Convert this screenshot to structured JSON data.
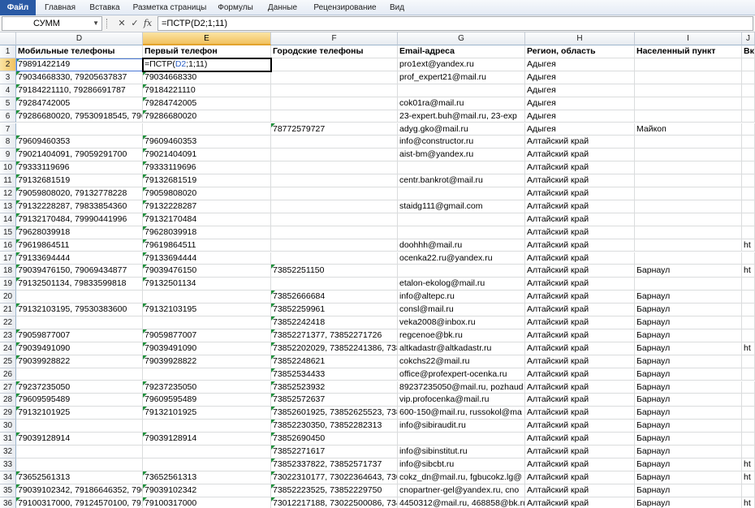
{
  "ribbon": {
    "tabs": [
      "Файл",
      "Главная",
      "Вставка",
      "Разметка страницы",
      "Формулы",
      "Данные",
      "Рецензирование",
      "Вид"
    ]
  },
  "formula_bar": {
    "name_box": "СУММ",
    "formula": "=ПСТР(D2;1;11)"
  },
  "active_cell": {
    "fn": "=ПСТР(",
    "ref": "D2",
    "rest": ";1;11)"
  },
  "columns": [
    "D",
    "E",
    "F",
    "G",
    "H",
    "I",
    "J"
  ],
  "header_row": [
    "Мобильные телефоны",
    "Первый телефон",
    "Городские телефоны",
    "Email-адреса",
    "Регион, область",
    "Населенный пункт",
    "Вк"
  ],
  "rows": [
    {
      "n": "2",
      "D": "79891422149",
      "E": "",
      "F": "",
      "G": "pro1ext@yandex.ru",
      "H": "Адыгея",
      "I": "",
      "J": ""
    },
    {
      "n": "3",
      "D": "79034668330, 79205637837",
      "E": "79034668330",
      "F": "",
      "G": "prof_expert21@mail.ru",
      "H": "Адыгея",
      "I": "",
      "J": ""
    },
    {
      "n": "4",
      "D": "79184221110, 79286691787",
      "E": "79184221110",
      "F": "",
      "G": "",
      "H": "Адыгея",
      "I": "",
      "J": ""
    },
    {
      "n": "5",
      "D": "79284742005",
      "E": "79284742005",
      "F": "",
      "G": "cok01ra@mail.ru",
      "H": "Адыгея",
      "I": "",
      "J": ""
    },
    {
      "n": "6",
      "D": "79286680020, 79530918545, 7961",
      "E": "79286680020",
      "F": "",
      "G": "23-expert.buh@mail.ru, 23-exp",
      "H": "Адыгея",
      "I": "",
      "J": ""
    },
    {
      "n": "7",
      "D": "",
      "E": "",
      "F": "78772579727",
      "G": "adyg.gko@mail.ru",
      "H": "Адыгея",
      "I": "Майкоп",
      "J": ""
    },
    {
      "n": "8",
      "D": "79609460353",
      "E": "79609460353",
      "F": "",
      "G": "info@constructor.ru",
      "H": "Алтайский край",
      "I": "",
      "J": ""
    },
    {
      "n": "9",
      "D": "79021404091, 79059291700",
      "E": "79021404091",
      "F": "",
      "G": "aist-bm@yandex.ru",
      "H": "Алтайский край",
      "I": "",
      "J": ""
    },
    {
      "n": "10",
      "D": "79333119696",
      "E": "79333119696",
      "F": "",
      "G": "",
      "H": "Алтайский край",
      "I": "",
      "J": ""
    },
    {
      "n": "11",
      "D": "79132681519",
      "E": "79132681519",
      "F": "",
      "G": "centr.bankrot@mail.ru",
      "H": "Алтайский край",
      "I": "",
      "J": ""
    },
    {
      "n": "12",
      "D": "79059808020, 79132778228",
      "E": "79059808020",
      "F": "",
      "G": "",
      "H": "Алтайский край",
      "I": "",
      "J": ""
    },
    {
      "n": "13",
      "D": "79132228287, 79833854360",
      "E": "79132228287",
      "F": "",
      "G": "staidg111@gmail.com",
      "H": "Алтайский край",
      "I": "",
      "J": ""
    },
    {
      "n": "14",
      "D": "79132170484, 79990441996",
      "E": "79132170484",
      "F": "",
      "G": "",
      "H": "Алтайский край",
      "I": "",
      "J": ""
    },
    {
      "n": "15",
      "D": "79628039918",
      "E": "79628039918",
      "F": "",
      "G": "",
      "H": "Алтайский край",
      "I": "",
      "J": ""
    },
    {
      "n": "16",
      "D": "79619864511",
      "E": "79619864511",
      "F": "",
      "G": "doohhh@mail.ru",
      "H": "Алтайский край",
      "I": "",
      "J": "ht"
    },
    {
      "n": "17",
      "D": "79133694444",
      "E": "79133694444",
      "F": "",
      "G": "ocenka22.ru@yandex.ru",
      "H": "Алтайский край",
      "I": "",
      "J": ""
    },
    {
      "n": "18",
      "D": "79039476150, 79069434877",
      "E": "79039476150",
      "F": "73852251150",
      "G": "",
      "H": "Алтайский край",
      "I": "Барнаул",
      "J": "ht"
    },
    {
      "n": "19",
      "D": "79132501134, 79833599818",
      "E": "79132501134",
      "F": "",
      "G": "etalon-ekolog@mail.ru",
      "H": "Алтайский край",
      "I": "",
      "J": ""
    },
    {
      "n": "20",
      "D": "",
      "E": "",
      "F": "73852666684",
      "G": "info@altepc.ru",
      "H": "Алтайский край",
      "I": "Барнаул",
      "J": ""
    },
    {
      "n": "21",
      "D": "79132103195, 79530383600",
      "E": "79132103195",
      "F": "73852259961",
      "G": "consl@mail.ru",
      "H": "Алтайский край",
      "I": "Барнаул",
      "J": ""
    },
    {
      "n": "22",
      "D": "",
      "E": "",
      "F": "73852242418",
      "G": "veka2008@inbox.ru",
      "H": "Алтайский край",
      "I": "Барнаул",
      "J": ""
    },
    {
      "n": "23",
      "D": "79059877007",
      "E": "79059877007",
      "F": "73852271377, 73852271726",
      "G": "regcenoe@bk.ru",
      "H": "Алтайский край",
      "I": "Барнаул",
      "J": ""
    },
    {
      "n": "24",
      "D": "79039491090",
      "E": "79039491090",
      "F": "73852202029, 73852241386, 7385",
      "G": "altkadastr@altkadastr.ru",
      "H": "Алтайский край",
      "I": "Барнаул",
      "J": "ht"
    },
    {
      "n": "25",
      "D": "79039928822",
      "E": "79039928822",
      "F": "73852248621",
      "G": "cokchs22@mail.ru",
      "H": "Алтайский край",
      "I": "Барнаул",
      "J": ""
    },
    {
      "n": "26",
      "D": "",
      "E": "",
      "F": "73852534433",
      "G": "office@profexpert-ocenka.ru",
      "H": "Алтайский край",
      "I": "Барнаул",
      "J": ""
    },
    {
      "n": "27",
      "D": "79237235050",
      "E": "79237235050",
      "F": "73852523932",
      "G": "89237235050@mail.ru, pozhaud",
      "H": "Алтайский край",
      "I": "Барнаул",
      "J": ""
    },
    {
      "n": "28",
      "D": "79609595489",
      "E": "79609595489",
      "F": "73852572637",
      "G": "vip.profocenka@mail.ru",
      "H": "Алтайский край",
      "I": "Барнаул",
      "J": ""
    },
    {
      "n": "29",
      "D": "79132101925",
      "E": "79132101925",
      "F": "73852601925, 73852625523, 7385",
      "G": "600-150@mail.ru, russokol@ma",
      "H": "Алтайский край",
      "I": "Барнаул",
      "J": ""
    },
    {
      "n": "30",
      "D": "",
      "E": "",
      "F": "73852230350, 73852282313",
      "G": "info@sibiraudit.ru",
      "H": "Алтайский край",
      "I": "Барнаул",
      "J": ""
    },
    {
      "n": "31",
      "D": "79039128914",
      "E": "79039128914",
      "F": "73852690450",
      "G": "",
      "H": "Алтайский край",
      "I": "Барнаул",
      "J": ""
    },
    {
      "n": "32",
      "D": "",
      "E": "",
      "F": "73852271617",
      "G": "info@sibinstitut.ru",
      "H": "Алтайский край",
      "I": "Барнаул",
      "J": ""
    },
    {
      "n": "33",
      "D": "",
      "E": "",
      "F": "73852337822, 73852571737",
      "G": "info@sibcbt.ru",
      "H": "Алтайский край",
      "I": "Барнаул",
      "J": "ht"
    },
    {
      "n": "34",
      "D": "73652561313",
      "E": "73652561313",
      "F": "73022310177, 73022364643, 7302",
      "G": "cokz_dn@mail.ru, fgbucokz.lg@",
      "H": "Алтайский край",
      "I": "Барнаул",
      "J": "ht"
    },
    {
      "n": "35",
      "D": "79039102342, 79186646352, 7960",
      "E": "79039102342",
      "F": "73852223525, 73852229750",
      "G": "cnopartner-gel@yandex.ru, cno",
      "H": "Алтайский край",
      "I": "Барнаул",
      "J": ""
    },
    {
      "n": "36",
      "D": "79100317000, 79124570100, 7914",
      "E": "79100317000",
      "F": "73012217188, 73022500086, 7345",
      "G": "4450312@mail.ru, 468858@bk.ru",
      "H": "Алтайский край",
      "I": "Барнаул",
      "J": "ht"
    }
  ]
}
